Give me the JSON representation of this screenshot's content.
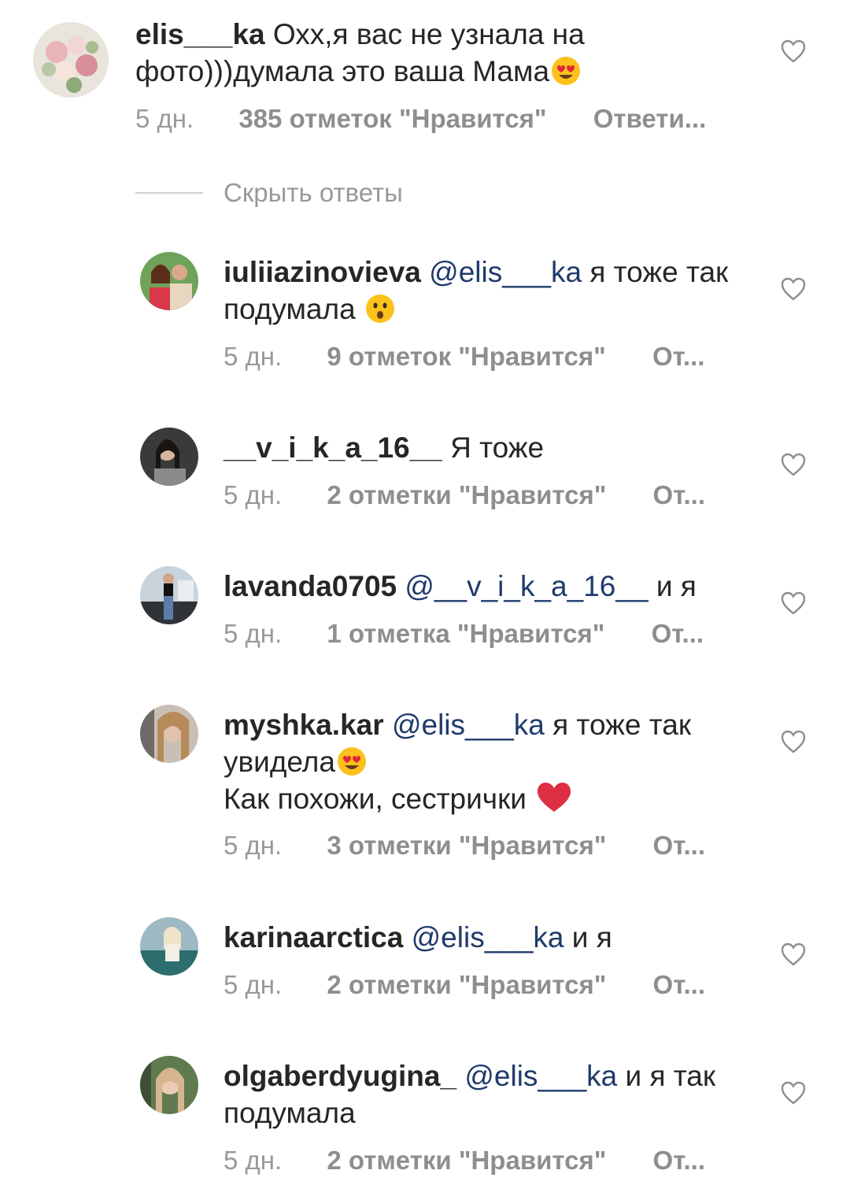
{
  "main_comment": {
    "username": "elis___ka",
    "text_line1": "Охх,я вас не узнала на",
    "text_line2": "фото)))думала это ваша Мама",
    "emoji": "heart-eyes-emoji",
    "time": "5 дн.",
    "likes": "385 отметок \"Нравится\"",
    "reply": "Ответи..."
  },
  "hide_replies_label": "Скрыть ответы",
  "replies": [
    {
      "username": "iuliiazinovieva",
      "mention": "@elis___ka",
      "text": "я тоже так",
      "text2": "подумала",
      "emoji": "hushed-face-emoji",
      "time": "5 дн.",
      "likes": "9 отметок \"Нравится\"",
      "reply": "От..."
    },
    {
      "username": "__v_i_k_a_16__",
      "text": "Я тоже",
      "time": "5 дн.",
      "likes": "2 отметки \"Нравится\"",
      "reply": "От..."
    },
    {
      "username": "lavanda0705",
      "mention": "@__v_i_k_a_16__",
      "text": "и я",
      "time": "5 дн.",
      "likes": "1 отметка \"Нравится\"",
      "reply": "От..."
    },
    {
      "username": "myshka.kar",
      "mention": "@elis___ka",
      "text": "я тоже так",
      "text2": "увидела",
      "emoji": "heart-eyes-emoji",
      "text3": "Как похожи, сестрички",
      "emoji3": "red-heart-emoji",
      "time": "5 дн.",
      "likes": "3 отметки \"Нравится\"",
      "reply": "От..."
    },
    {
      "username": "karinaarctica",
      "mention": "@elis___ka",
      "text": "и я",
      "time": "5 дн.",
      "likes": "2 отметки \"Нравится\"",
      "reply": "От..."
    },
    {
      "username": "olgaberdyugina_",
      "mention": "@elis___ka",
      "text": "и я так",
      "text2": "подумала",
      "time": "5 дн.",
      "likes": "2 отметки \"Нравится\"",
      "reply": "От..."
    }
  ],
  "colors": {
    "mention": "#1f3a6b",
    "meta": "#999999",
    "text": "#262626"
  }
}
